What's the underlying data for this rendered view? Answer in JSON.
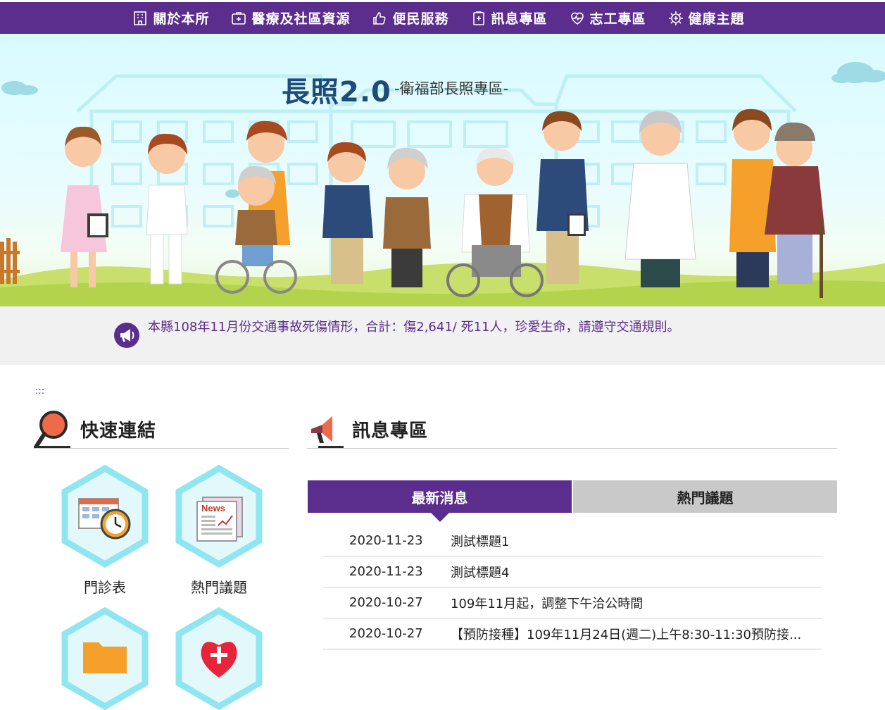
{
  "nav": {
    "items": [
      {
        "label": "關於本所",
        "icon": "building-icon"
      },
      {
        "label": "醫療及社區資源",
        "icon": "medical-kit-icon"
      },
      {
        "label": "便民服務",
        "icon": "thumbs-up-icon"
      },
      {
        "label": "訊息專區",
        "icon": "clipboard-icon"
      },
      {
        "label": "志工專區",
        "icon": "heart-pulse-icon"
      },
      {
        "label": "健康主題",
        "icon": "gear-health-icon"
      }
    ]
  },
  "banner": {
    "title": "長照2.0",
    "subtitle": "-衛福部長照專區-"
  },
  "marquee": {
    "icon": "megaphone-icon",
    "text": "本縣108年11月份交通事故死傷情形，合計：傷2,641/ 死11人，珍愛生命，請遵守交通規則。"
  },
  "accesskey": ":::",
  "quick_links": {
    "title": "快速連結",
    "icon": "magnifier-icon",
    "items": [
      {
        "label": "門診表",
        "icon": "schedule-clock-icon"
      },
      {
        "label": "熱門議題",
        "icon": "newspaper-icon"
      },
      {
        "label": "",
        "icon": "folder-icon"
      },
      {
        "label": "",
        "icon": "health-heart-icon"
      }
    ]
  },
  "news": {
    "title": "訊息專區",
    "icon": "megaphone-icon",
    "tabs": [
      {
        "label": "最新消息",
        "active": true
      },
      {
        "label": "熱門議題",
        "active": false
      }
    ],
    "items": [
      {
        "date": "2020-11-23",
        "title": "測試標題1"
      },
      {
        "date": "2020-11-23",
        "title": "測試標題4"
      },
      {
        "date": "2020-10-27",
        "title": "109年11月起，調整下午洽公時間"
      },
      {
        "date": "2020-10-27",
        "title": "【預防接種】109年11月24日(週二)上午8:30-11:30預防接..."
      }
    ]
  },
  "colors": {
    "brand": "#5b2d8c",
    "tab_inactive": "#c9c9c9",
    "banner_title": "#1d4b7a"
  }
}
